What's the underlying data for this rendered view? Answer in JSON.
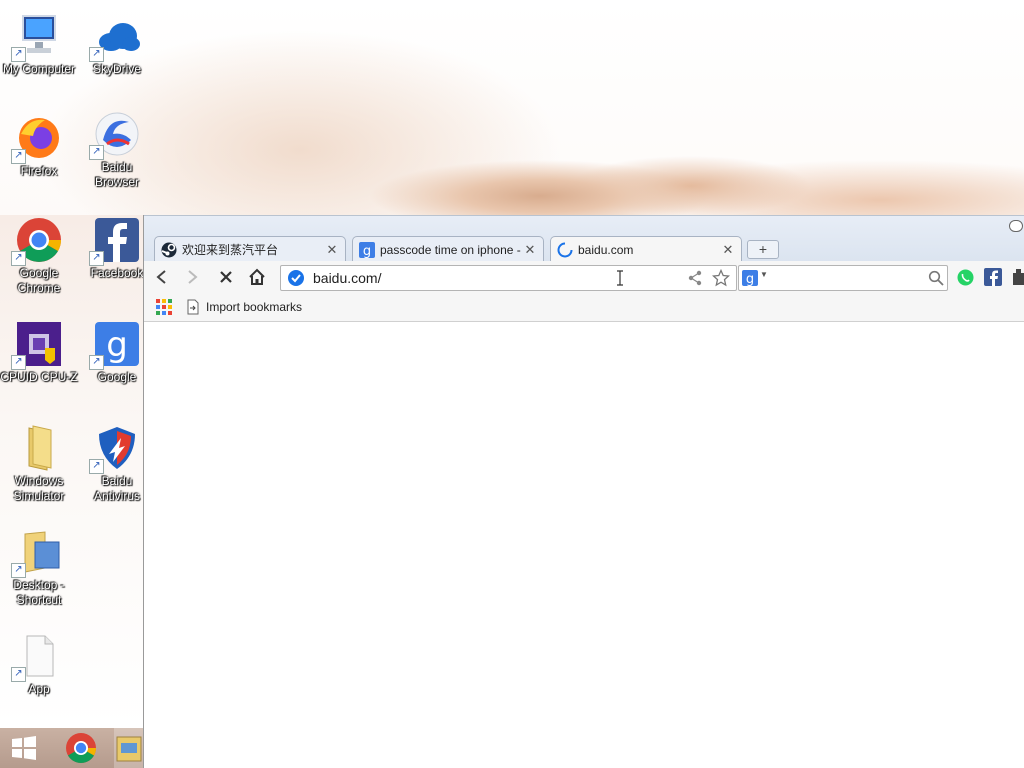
{
  "desktop": {
    "icons": [
      {
        "label": "My Computer",
        "icon": "computer-icon"
      },
      {
        "label": "SkyDrive",
        "icon": "cloud-icon"
      },
      {
        "label": "Firefox",
        "icon": "firefox-icon"
      },
      {
        "label": "Baidu Browser",
        "icon": "baidu-browser-icon"
      },
      {
        "label": "Google Chrome",
        "icon": "chrome-icon"
      },
      {
        "label": "Facebook",
        "icon": "facebook-icon"
      },
      {
        "label": "CPUID CPU-Z",
        "icon": "cpuz-icon"
      },
      {
        "label": "Google",
        "icon": "google-icon"
      },
      {
        "label": "Windows Simulator",
        "icon": "folder-icon"
      },
      {
        "label": "Baidu Antivirus",
        "icon": "shield-icon"
      },
      {
        "label": "Desktop - Shortcut",
        "icon": "desktop-shortcut-icon"
      },
      {
        "label": "App",
        "icon": "file-icon"
      }
    ]
  },
  "taskbar": {
    "items": [
      "start-icon",
      "chrome-icon",
      "explorer-icon"
    ]
  },
  "browser": {
    "tabs": [
      {
        "title": "欢迎来到蒸汽平台",
        "icon": "steam-icon",
        "active": false
      },
      {
        "title": "passcode time on iphone -",
        "icon": "google-icon",
        "active": false
      },
      {
        "title": "baidu.com",
        "icon": "loading-icon",
        "active": true
      }
    ],
    "address": "baidu.com/",
    "search_placeholder": "",
    "bookmarks": {
      "import_label": "Import bookmarks"
    },
    "colors": {
      "accent": "#1a73e8",
      "facebook": "#3b5998",
      "whatsapp": "#25d366"
    }
  }
}
